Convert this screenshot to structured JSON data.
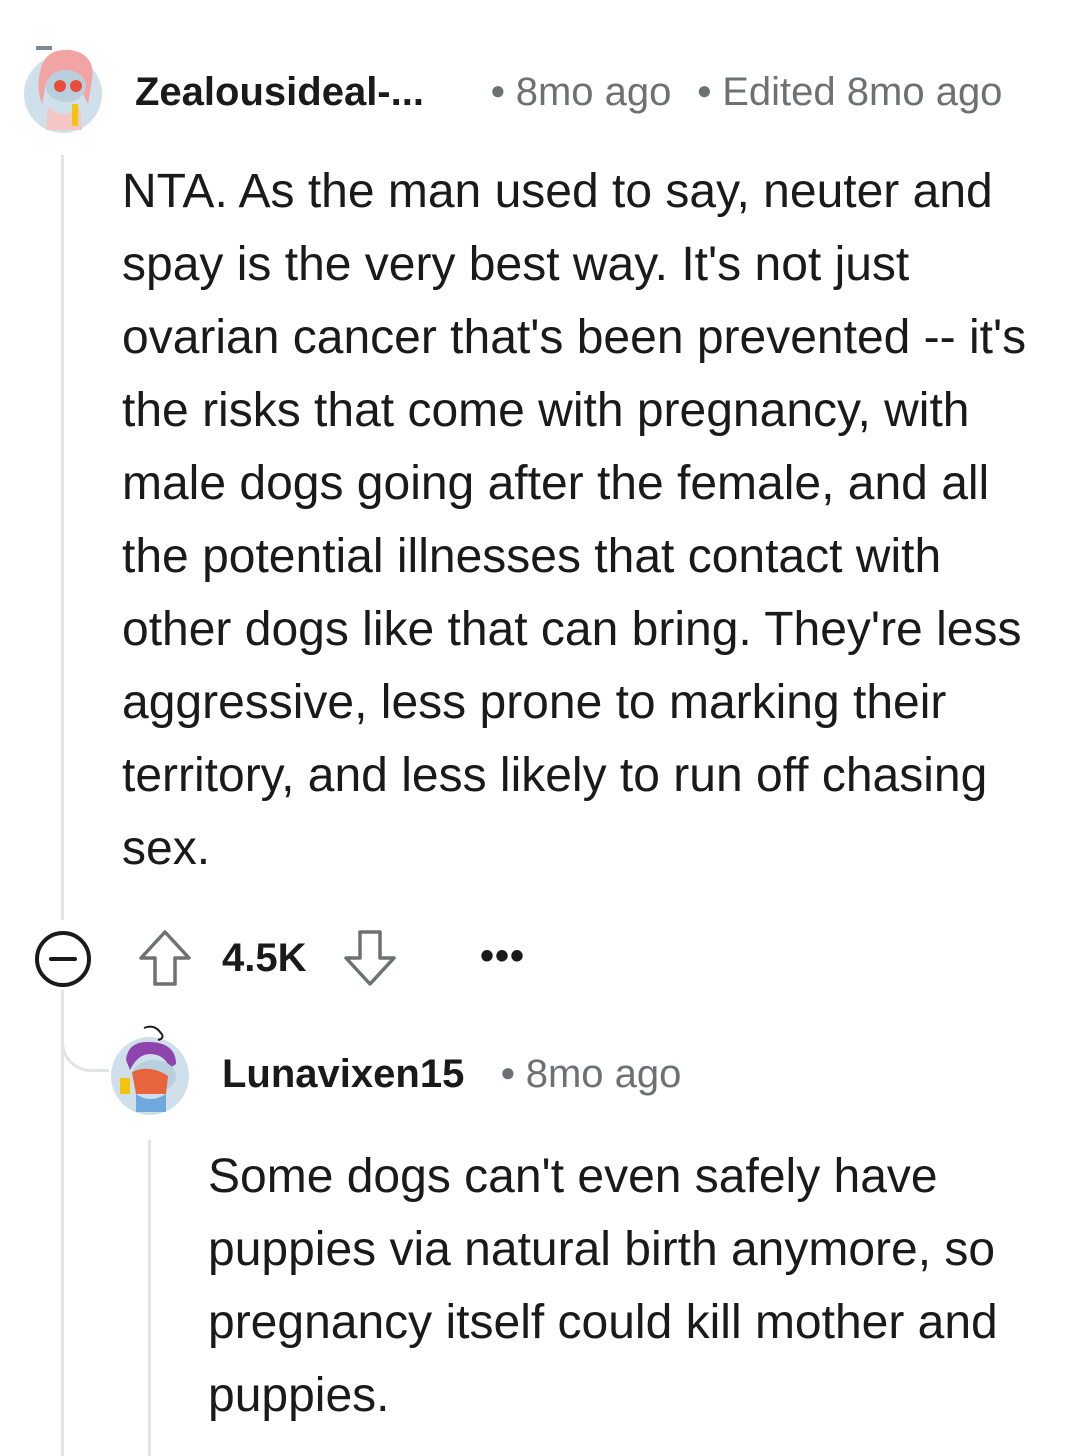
{
  "comments": [
    {
      "username": "Zealousideal-...",
      "age": "8mo ago",
      "edited": "Edited 8mo ago",
      "body": "NTA. As the man used to say, neuter and spay is the very best way. It's not just ovarian cancer that's been prevented -- it's the risks that come with pregnancy, with male dogs going after the female, and all the potential illnesses that contact with other dogs like that can bring. They're less aggressive, less prone to marking their territory, and less likely to run off chasing sex.",
      "score": "4.5K",
      "more_label": "•••"
    },
    {
      "username": "Lunavixen15",
      "age": "8mo ago",
      "body": "Some dogs can't even safely have puppies via natural birth anymore, so pregnancy itself could kill mother and puppies."
    }
  ],
  "icons": {
    "collapse": "collapse-minus-icon",
    "upvote": "upvote-arrow-icon",
    "downvote": "downvote-arrow-icon",
    "more": "more-options-icon"
  },
  "colors": {
    "text": "#1a1a1b",
    "meta": "#6e7173",
    "thread_line": "#e3e4e5"
  }
}
